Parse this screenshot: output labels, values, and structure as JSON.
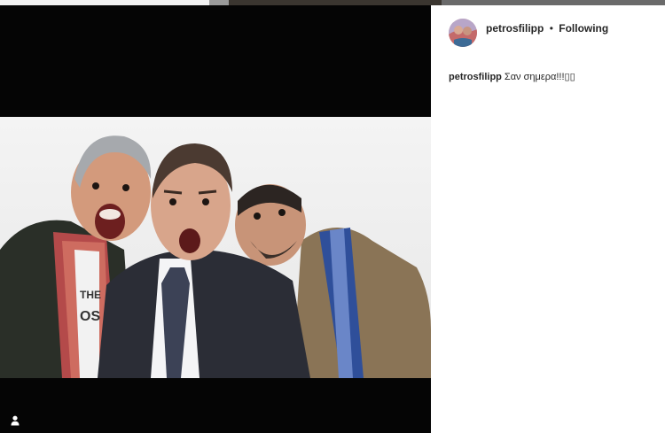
{
  "post": {
    "username": "petrosfilipp",
    "separator": "•",
    "follow_status": "Following",
    "caption_user": "petrosfilipp",
    "caption_text": "Σαν σημερα!!!▯▯"
  },
  "icons": {
    "tagged_people": "person-icon",
    "avatar": "profile-avatar"
  },
  "colors": {
    "media_background": "#050505",
    "text": "#262626",
    "panel_background": "#ffffff"
  }
}
